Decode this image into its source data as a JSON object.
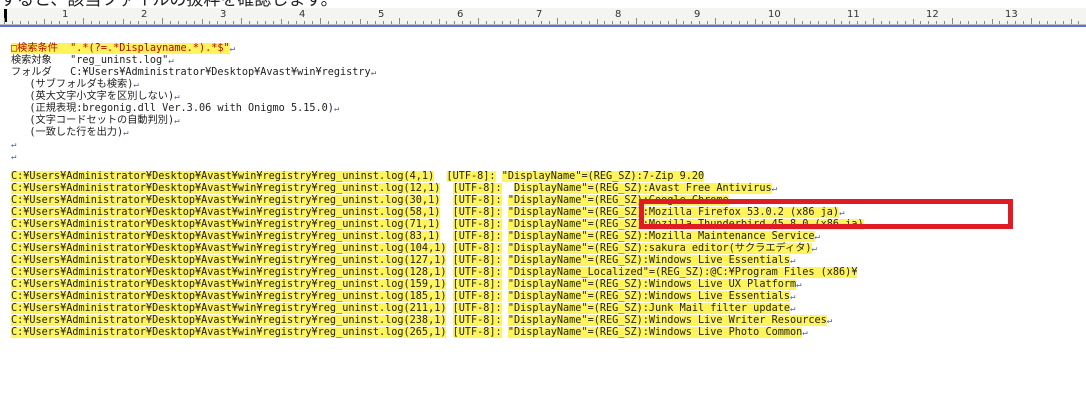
{
  "caption": "すると、該当ファイルの抜粋を確認します。",
  "ruler": {
    "numbers": [
      "0",
      "1",
      "2",
      "3",
      "4",
      "5",
      "6",
      "7",
      "8",
      "9",
      "10",
      "11",
      "12",
      "13"
    ]
  },
  "header": {
    "condition": "□検索条件  \".*(?=.*Displayname.*).*$\"",
    "target": "検索対象   \"reg_uninst.log\"",
    "folder": "フォルダ   C:¥Users¥Administrator¥Desktop¥Avast¥win¥registry",
    "opt1": "   (サブフォルダも検索)",
    "opt2": "   (英大文字小文字を区別しない)",
    "opt3": "   (正規表現:bregonig.dll Ver.3.06 with Onigmo 5.15.0)",
    "opt4": "   (文字コードセットの自動判別)",
    "opt5": "   (一致した行を出力)"
  },
  "cr_glyph": "↵",
  "results": [
    {
      "path": "C:¥Users¥Administrator¥Desktop¥Avast¥win¥registry¥reg_uninst.log(4,1)",
      "enc": "[UTF-8]:",
      "text": "\"DisplayName\"=(REG_SZ):7-Zip 9.20"
    },
    {
      "path": "C:¥Users¥Administrator¥Desktop¥Avast¥win¥registry¥reg_uninst.log(12,1)",
      "enc": "[UTF-8]:",
      "text": "DisplayName\"=(REG_SZ):Avast Free Antivirus"
    },
    {
      "path": "C:¥Users¥Administrator¥Desktop¥Avast¥win¥registry¥reg_uninst.log(30,1)",
      "enc": "[UTF-8]:",
      "text": "\"DisplayName\"=(REG_SZ):Google Chrome"
    },
    {
      "path": "C:¥Users¥Administrator¥Desktop¥Avast¥win¥registry¥reg_uninst.log(58,1)",
      "enc": "[UTF-8]:",
      "text": "\"DisplayName\"=(REG_SZ):Mozilla Firefox 53.0.2 (x86 ja)"
    },
    {
      "path": "C:¥Users¥Administrator¥Desktop¥Avast¥win¥registry¥reg_uninst.log(71,1)",
      "enc": "[UTF-8]:",
      "text": "\"DisplayName\"=(REG_SZ):Mozilla Thunderbird 45.8.0 (x86 ja)"
    },
    {
      "path": "C:¥Users¥Administrator¥Desktop¥Avast¥win¥registry¥reg_uninst.log(83,1)",
      "enc": "[UTF-8]:",
      "text": "\"DisplayName\"=(REG_SZ):Mozilla Maintenance Service"
    },
    {
      "path": "C:¥Users¥Administrator¥Desktop¥Avast¥win¥registry¥reg_uninst.log(104,1)",
      "enc": "[UTF-8]:",
      "text": "\"DisplayName\"=(REG_SZ):sakura editor(サクラエディタ)"
    },
    {
      "path": "C:¥Users¥Administrator¥Desktop¥Avast¥win¥registry¥reg_uninst.log(127,1)",
      "enc": "[UTF-8]:",
      "text": "\"DisplayName\"=(REG_SZ):Windows Live Essentials"
    },
    {
      "path": "C:¥Users¥Administrator¥Desktop¥Avast¥win¥registry¥reg_uninst.log(128,1)",
      "enc": "[UTF-8]:",
      "text": "\"DisplayName_Localized\"=(REG_SZ):@C:¥Program Files (x86)¥"
    },
    {
      "path": "C:¥Users¥Administrator¥Desktop¥Avast¥win¥registry¥reg_uninst.log(159,1)",
      "enc": "[UTF-8]:",
      "text": "\"DisplayName\"=(REG_SZ):Windows Live UX Platform"
    },
    {
      "path": "C:¥Users¥Administrator¥Desktop¥Avast¥win¥registry¥reg_uninst.log(185,1)",
      "enc": "[UTF-8]:",
      "text": "\"DisplayName\"=(REG_SZ):Windows Live Essentials"
    },
    {
      "path": "C:¥Users¥Administrator¥Desktop¥Avast¥win¥registry¥reg_uninst.log(211,1)",
      "enc": "[UTF-8]:",
      "text": "\"DisplayName\"=(REG_SZ):Junk Mail filter update"
    },
    {
      "path": "C:¥Users¥Administrator¥Desktop¥Avast¥win¥registry¥reg_uninst.log(238,1)",
      "enc": "[UTF-8]:",
      "text": "\"DisplayName\"=(REG_SZ):Windows Live Writer Resources"
    },
    {
      "path": "C:¥Users¥Administrator¥Desktop¥Avast¥win¥registry¥reg_uninst.log(265,1)",
      "enc": "[UTF-8]:",
      "text": "\"DisplayName\"=(REG_SZ):Windows Live Photo Common"
    }
  ],
  "colors": {
    "highlight": "#fff55a",
    "annotation_box": "#e01b24",
    "line_end": "#3d61d4"
  }
}
